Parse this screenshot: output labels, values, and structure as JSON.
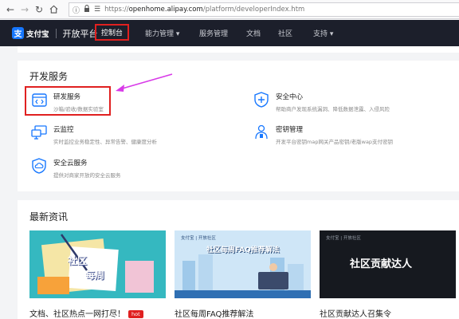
{
  "browser": {
    "url_prefix": "https://",
    "url_host": "openhome.alipay.com",
    "url_path": "/platform/developerIndex.htm"
  },
  "nav": {
    "logo_char": "支",
    "brand_name": "支付宝",
    "title": "开放平台",
    "items": [
      {
        "label": "控制台",
        "active": true
      },
      {
        "label": "能力管理 ▾"
      },
      {
        "label": "服务管理"
      },
      {
        "label": "文档"
      },
      {
        "label": "社区"
      },
      {
        "label": "支持 ▾"
      }
    ]
  },
  "dev_services": {
    "title": "开发服务",
    "items": [
      {
        "title": "研发服务",
        "desc": "沙箱/验收/数据实验室",
        "icon": "code-icon"
      },
      {
        "title": "安全中心",
        "desc": "帮助商户发现系统漏洞、降低数据泄露、入侵风险",
        "icon": "shield-plus-icon"
      },
      {
        "title": "云监控",
        "desc": "实时监控业务稳定性、异常告警、健康度分析",
        "icon": "monitor-icon"
      },
      {
        "title": "密钥管理",
        "desc": "开发平台密钥map网关产品密钥/老版wap支付密钥",
        "icon": "key-person-icon"
      },
      {
        "title": "安全云服务",
        "desc": "提供对商家开放的安全云服务",
        "icon": "cloud-shield-icon"
      }
    ]
  },
  "news": {
    "title": "最新资讯",
    "items": [
      {
        "caption": "文档、社区热点一网打尽！",
        "badge": "hot",
        "thumb_text_1": "社区",
        "thumb_text_2": "每周"
      },
      {
        "caption": "社区每周FAQ推荐解法",
        "thumb_text": "社区每周FAQ推荐解法",
        "thumb_logo": "支付宝 | 开放社区"
      },
      {
        "caption": "社区贡献达人召集令",
        "thumb_text": "社区贡献达人",
        "thumb_logo": "支付宝 | 开放社区"
      }
    ]
  },
  "colors": {
    "accent": "#1677ff",
    "nav_bg": "#1c1f2b",
    "highlight": "#e02020",
    "arrow": "#d83ae8"
  }
}
